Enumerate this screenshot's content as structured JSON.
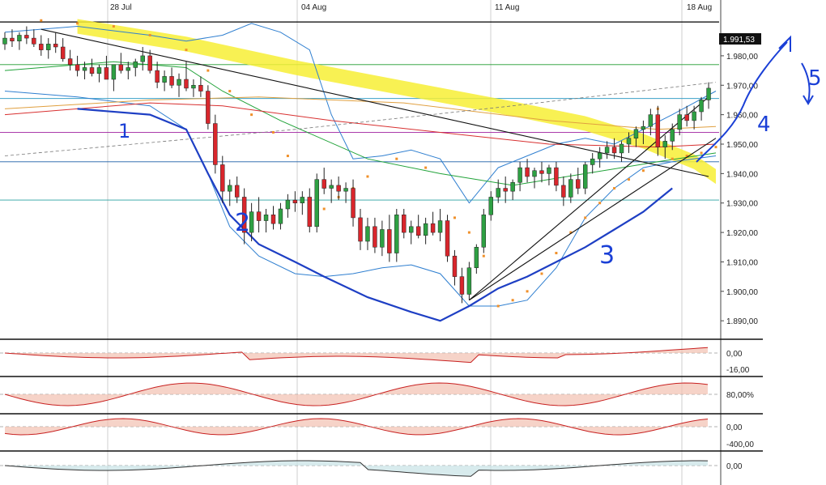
{
  "chart_data": {
    "type": "candlestick",
    "x_labels": [
      "28 Jul",
      "04 Aug",
      "11 Aug",
      "18 Aug"
    ],
    "price_panel": {
      "y_ticks": [
        "1.980,00",
        "1.970,00",
        "1.960,00",
        "1.950,00",
        "1.940,00",
        "1.930,00",
        "1.920,00",
        "1.910,00",
        "1.900,00",
        "1.890,00"
      ],
      "ylim": [
        1884,
        1994
      ],
      "last_value_label": "1.991,53",
      "horizontal_levels": [
        1991.5,
        1977,
        1965.5,
        1954,
        1944,
        1931
      ],
      "candles": [
        [
          1984,
          1988,
          1982,
          1986
        ],
        [
          1986,
          1989,
          1983,
          1985
        ],
        [
          1985,
          1988,
          1982,
          1987
        ],
        [
          1987,
          1990,
          1984,
          1986
        ],
        [
          1986,
          1989,
          1983,
          1984
        ],
        [
          1984,
          1987,
          1980,
          1982
        ],
        [
          1982,
          1986,
          1979,
          1984
        ],
        [
          1984,
          1988,
          1981,
          1983
        ],
        [
          1983,
          1986,
          1978,
          1979
        ],
        [
          1979,
          1982,
          1975,
          1977
        ],
        [
          1977,
          1980,
          1973,
          1975
        ],
        [
          1975,
          1978,
          1972,
          1976
        ],
        [
          1976,
          1979,
          1973,
          1974
        ],
        [
          1974,
          1977,
          1971,
          1976
        ],
        [
          1976,
          1980,
          1973,
          1972
        ],
        [
          1972,
          1975,
          1968,
          1977
        ],
        [
          1977,
          1981,
          1974,
          1975
        ],
        [
          1975,
          1978,
          1972,
          1976
        ],
        [
          1976,
          1979,
          1973,
          1978
        ],
        [
          1978,
          1983,
          1975,
          1980
        ],
        [
          1980,
          1982,
          1974,
          1975
        ],
        [
          1975,
          1978,
          1969,
          1971
        ],
        [
          1971,
          1975,
          1968,
          1973
        ],
        [
          1973,
          1976,
          1969,
          1970
        ],
        [
          1970,
          1974,
          1966,
          1972
        ],
        [
          1972,
          1978,
          1968,
          1969
        ],
        [
          1969,
          1972,
          1966,
          1970
        ],
        [
          1970,
          1973,
          1966,
          1968
        ],
        [
          1968,
          1970,
          1955,
          1957
        ],
        [
          1957,
          1960,
          1940,
          1943
        ],
        [
          1943,
          1946,
          1930,
          1934
        ],
        [
          1934,
          1938,
          1929,
          1936
        ],
        [
          1936,
          1939,
          1930,
          1932
        ],
        [
          1932,
          1935,
          1916,
          1920
        ],
        [
          1920,
          1930,
          1917,
          1927
        ],
        [
          1927,
          1932,
          1920,
          1924
        ],
        [
          1924,
          1928,
          1920,
          1926
        ],
        [
          1926,
          1929,
          1921,
          1923
        ],
        [
          1923,
          1930,
          1921,
          1928
        ],
        [
          1928,
          1933,
          1925,
          1931
        ],
        [
          1931,
          1934,
          1927,
          1930
        ],
        [
          1930,
          1934,
          1926,
          1932
        ],
        [
          1932,
          1935,
          1920,
          1922
        ],
        [
          1922,
          1940,
          1920,
          1938
        ],
        [
          1938,
          1942,
          1933,
          1935
        ],
        [
          1935,
          1938,
          1930,
          1936
        ],
        [
          1936,
          1939,
          1931,
          1934
        ],
        [
          1934,
          1937,
          1930,
          1935
        ],
        [
          1935,
          1938,
          1922,
          1925
        ],
        [
          1925,
          1928,
          1914,
          1917
        ],
        [
          1917,
          1925,
          1914,
          1922
        ],
        [
          1922,
          1925,
          1913,
          1915
        ],
        [
          1915,
          1924,
          1912,
          1921
        ],
        [
          1921,
          1926,
          1910,
          1913
        ],
        [
          1913,
          1928,
          1910,
          1926
        ],
        [
          1926,
          1928,
          1918,
          1920
        ],
        [
          1920,
          1924,
          1916,
          1922
        ],
        [
          1922,
          1926,
          1918,
          1919
        ],
        [
          1919,
          1925,
          1916,
          1923
        ],
        [
          1923,
          1927,
          1919,
          1920
        ],
        [
          1920,
          1928,
          1917,
          1924
        ],
        [
          1924,
          1926,
          1910,
          1912
        ],
        [
          1912,
          1914,
          1902,
          1905
        ],
        [
          1905,
          1908,
          1896,
          1899
        ],
        [
          1899,
          1910,
          1897,
          1908
        ],
        [
          1908,
          1916,
          1906,
          1915
        ],
        [
          1915,
          1928,
          1913,
          1926
        ],
        [
          1926,
          1934,
          1924,
          1932
        ],
        [
          1932,
          1938,
          1930,
          1935
        ],
        [
          1935,
          1939,
          1930,
          1934
        ],
        [
          1934,
          1938,
          1931,
          1937
        ],
        [
          1937,
          1944,
          1934,
          1942
        ],
        [
          1942,
          1945,
          1937,
          1939
        ],
        [
          1939,
          1942,
          1935,
          1941
        ],
        [
          1941,
          1944,
          1937,
          1940
        ],
        [
          1940,
          1943,
          1936,
          1942
        ],
        [
          1942,
          1944,
          1934,
          1936
        ],
        [
          1936,
          1939,
          1929,
          1932
        ],
        [
          1932,
          1940,
          1930,
          1938
        ],
        [
          1938,
          1942,
          1933,
          1935
        ],
        [
          1935,
          1944,
          1933,
          1943
        ],
        [
          1943,
          1947,
          1940,
          1945
        ],
        [
          1945,
          1949,
          1942,
          1947
        ],
        [
          1947,
          1951,
          1945,
          1949
        ],
        [
          1949,
          1952,
          1945,
          1947
        ],
        [
          1947,
          1951,
          1944,
          1950
        ],
        [
          1950,
          1954,
          1947,
          1952
        ],
        [
          1952,
          1956,
          1949,
          1955
        ],
        [
          1955,
          1958,
          1950,
          1956
        ],
        [
          1956,
          1962,
          1953,
          1960
        ],
        [
          1960,
          1963,
          1946,
          1949
        ],
        [
          1949,
          1953,
          1945,
          1951
        ],
        [
          1951,
          1957,
          1948,
          1955
        ],
        [
          1955,
          1962,
          1953,
          1960
        ],
        [
          1960,
          1963,
          1956,
          1958
        ],
        [
          1958,
          1963,
          1955,
          1961
        ],
        [
          1961,
          1966,
          1958,
          1965
        ],
        [
          1965,
          1971,
          1962,
          1969
        ]
      ],
      "bollinger_upper": [
        [
          0,
          1988
        ],
        [
          10,
          1990
        ],
        [
          20,
          1987
        ],
        [
          25,
          1985
        ],
        [
          30,
          1987
        ],
        [
          34,
          1991
        ],
        [
          38,
          1988
        ],
        [
          42,
          1982
        ],
        [
          45,
          1960
        ],
        [
          48,
          1945
        ],
        [
          52,
          1946
        ],
        [
          56,
          1948
        ],
        [
          60,
          1945
        ],
        [
          64,
          1930
        ],
        [
          68,
          1942
        ],
        [
          72,
          1946
        ],
        [
          76,
          1950
        ],
        [
          80,
          1952
        ],
        [
          84,
          1950
        ],
        [
          88,
          1955
        ],
        [
          92,
          1960
        ],
        [
          98,
          1968
        ]
      ],
      "bollinger_lower": [
        [
          0,
          1968
        ],
        [
          10,
          1966
        ],
        [
          20,
          1963
        ],
        [
          25,
          1955
        ],
        [
          28,
          1940
        ],
        [
          31,
          1922
        ],
        [
          35,
          1912
        ],
        [
          40,
          1906
        ],
        [
          44,
          1905
        ],
        [
          48,
          1906
        ],
        [
          52,
          1908
        ],
        [
          56,
          1909
        ],
        [
          60,
          1906
        ],
        [
          64,
          1895
        ],
        [
          68,
          1895
        ],
        [
          72,
          1897
        ],
        [
          76,
          1908
        ],
        [
          80,
          1925
        ],
        [
          84,
          1935
        ],
        [
          88,
          1942
        ],
        [
          92,
          1944
        ],
        [
          98,
          1946
        ]
      ],
      "moving_average_green": [
        [
          0,
          1975
        ],
        [
          15,
          1978
        ],
        [
          25,
          1976
        ],
        [
          30,
          1968
        ],
        [
          38,
          1958
        ],
        [
          50,
          1945
        ],
        [
          60,
          1940
        ],
        [
          70,
          1936
        ],
        [
          80,
          1940
        ],
        [
          90,
          1944
        ],
        [
          98,
          1947
        ]
      ],
      "moving_average_red": [
        [
          0,
          1960
        ],
        [
          20,
          1964
        ],
        [
          30,
          1963
        ],
        [
          45,
          1958
        ],
        [
          60,
          1954
        ],
        [
          75,
          1950
        ],
        [
          90,
          1949
        ],
        [
          98,
          1950
        ]
      ],
      "moving_average_orange": [
        [
          0,
          1962
        ],
        [
          20,
          1965
        ],
        [
          35,
          1966
        ],
        [
          55,
          1964
        ],
        [
          75,
          1958
        ],
        [
          90,
          1955
        ],
        [
          98,
          1956
        ]
      ],
      "parabolic_sar": [
        [
          5,
          1992
        ],
        [
          10,
          1991
        ],
        [
          15,
          1990
        ],
        [
          20,
          1987
        ],
        [
          25,
          1982
        ],
        [
          28,
          1975
        ],
        [
          31,
          1968
        ],
        [
          34,
          1960
        ],
        [
          37,
          1954
        ],
        [
          39,
          1946
        ],
        [
          42,
          1925
        ],
        [
          44,
          1928
        ],
        [
          46,
          1932
        ],
        [
          48,
          1935
        ],
        [
          50,
          1939
        ],
        [
          54,
          1945
        ],
        [
          58,
          1942
        ],
        [
          62,
          1925
        ],
        [
          64,
          1920
        ],
        [
          66,
          1912
        ],
        [
          68,
          1895
        ],
        [
          70,
          1897
        ],
        [
          72,
          1900
        ],
        [
          74,
          1906
        ],
        [
          76,
          1913
        ],
        [
          78,
          1920
        ],
        [
          80,
          1925
        ],
        [
          82,
          1930
        ],
        [
          84,
          1935
        ],
        [
          86,
          1938
        ],
        [
          88,
          1941
        ],
        [
          90,
          1962
        ],
        [
          92,
          1945
        ],
        [
          94,
          1946
        ],
        [
          96,
          1947
        ],
        [
          98,
          1949
        ]
      ],
      "annotations": [
        "1",
        "2",
        "3",
        "4",
        "5"
      ]
    },
    "indicator_panels": [
      {
        "y_ticks": [
          "0,00",
          "-16,00"
        ],
        "type": "macd"
      },
      {
        "y_ticks": [
          "80,00%"
        ],
        "type": "stochastic"
      },
      {
        "y_ticks": [
          "0,00",
          "-400,00"
        ],
        "type": "cci"
      },
      {
        "y_ticks": [
          "0,00"
        ],
        "type": "momentum"
      }
    ]
  }
}
